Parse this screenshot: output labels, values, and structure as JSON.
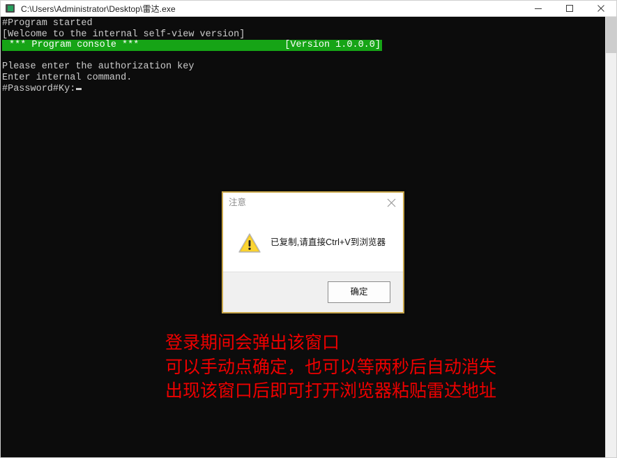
{
  "window": {
    "title": "C:\\Users\\Administrator\\Desktop\\雷达.exe",
    "icon": "console-app-icon",
    "controls": {
      "minimize": "minimize-button",
      "maximize": "maximize-button",
      "close": "close-button"
    }
  },
  "console": {
    "lines": [
      "#Program started",
      "[Welcome to the internal self-view version]"
    ],
    "banner": {
      "left": "*** Program console ***",
      "right": "[Version 1.0.0.0]",
      "background": "#16a416",
      "color": "#ffffff"
    },
    "lines_after": [
      "",
      "Please enter the authorization key",
      "Enter internal command.",
      "#Password#Ky:"
    ],
    "background": "#0c0c0c",
    "foreground": "#cccccc"
  },
  "dialog": {
    "title": "注意",
    "close_label": "×",
    "icon": "warning-triangle-icon",
    "message": "已复制,请直接Ctrl+V到浏览器",
    "ok_label": "确定",
    "border_color": "#c8a64a"
  },
  "annotation": {
    "color": "#ee0000",
    "lines": [
      "登录期间会弹出该窗口",
      "可以手动点确定，也可以等两秒后自动消失",
      "出现该窗口后即可打开浏览器粘贴雷达地址"
    ]
  }
}
